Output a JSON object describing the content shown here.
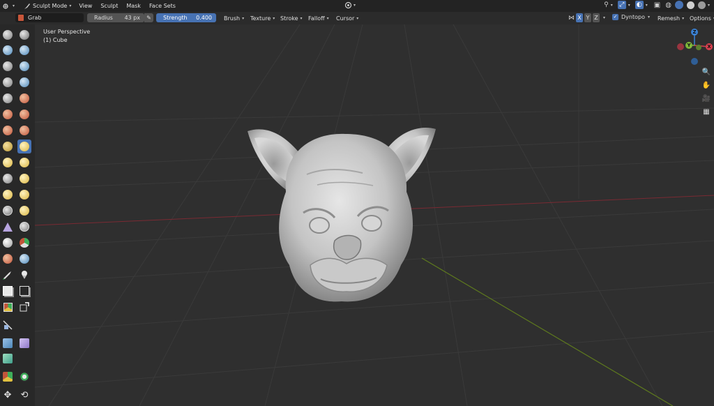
{
  "topbar": {
    "mode_label": "Sculpt Mode",
    "menus": [
      "View",
      "Sculpt",
      "Mask",
      "Face Sets"
    ]
  },
  "toolheader": {
    "brush_name": "Grab",
    "radius_label": "Radius",
    "radius_value": "43 px",
    "strength_label": "Strength",
    "strength_value": "0.400",
    "dropdowns": [
      "Brush",
      "Texture",
      "Stroke",
      "Falloff",
      "Cursor"
    ],
    "axes": [
      "X",
      "Y",
      "Z"
    ],
    "dyntopo_label": "Dyntopo",
    "remesh_label": "Remesh",
    "options_label": "Options"
  },
  "viewport": {
    "perspective_label": "User Perspective",
    "object_label": "(1) Cube"
  },
  "gizmo": {
    "z_label": "Z",
    "y_label": "Y",
    "x_label": "X"
  },
  "colors": {
    "accent": "#4772b3",
    "x_axis": "#d8404f",
    "y_axis": "#7fb83a",
    "z_axis": "#3a82d6"
  }
}
